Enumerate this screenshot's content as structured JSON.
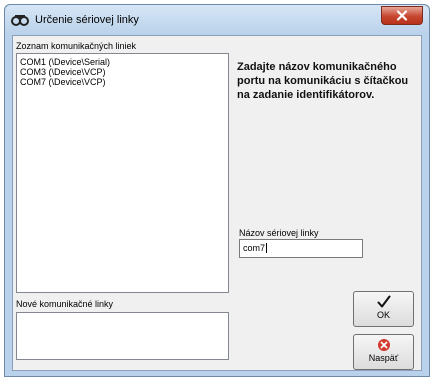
{
  "window": {
    "title": "Určenie sériovej linky"
  },
  "ports": {
    "label": "Zoznam komunikačných liniek",
    "items": [
      "COM1 (\\Device\\Serial)",
      "COM3 (\\Device\\VCP)",
      "COM7 (\\Device\\VCP)"
    ]
  },
  "new_lines": {
    "label": "Nové komunikačné linky"
  },
  "instructions": "Zadajte názov komunikačného portu na komunikáciu s čítačkou na zadanie identifikátorov.",
  "serial_name": {
    "label": "Názov sériovej linky",
    "value": "com7"
  },
  "buttons": {
    "ok": {
      "label": "OK",
      "icon": "checkmark-icon"
    },
    "back": {
      "label": "Naspäť",
      "icon": "cancel-icon"
    }
  },
  "colors": {
    "frame": "#b9d1ea",
    "close_button": "#c7462f",
    "client_bg": "#f0f0f0",
    "cancel_icon": "#d23a2c"
  }
}
